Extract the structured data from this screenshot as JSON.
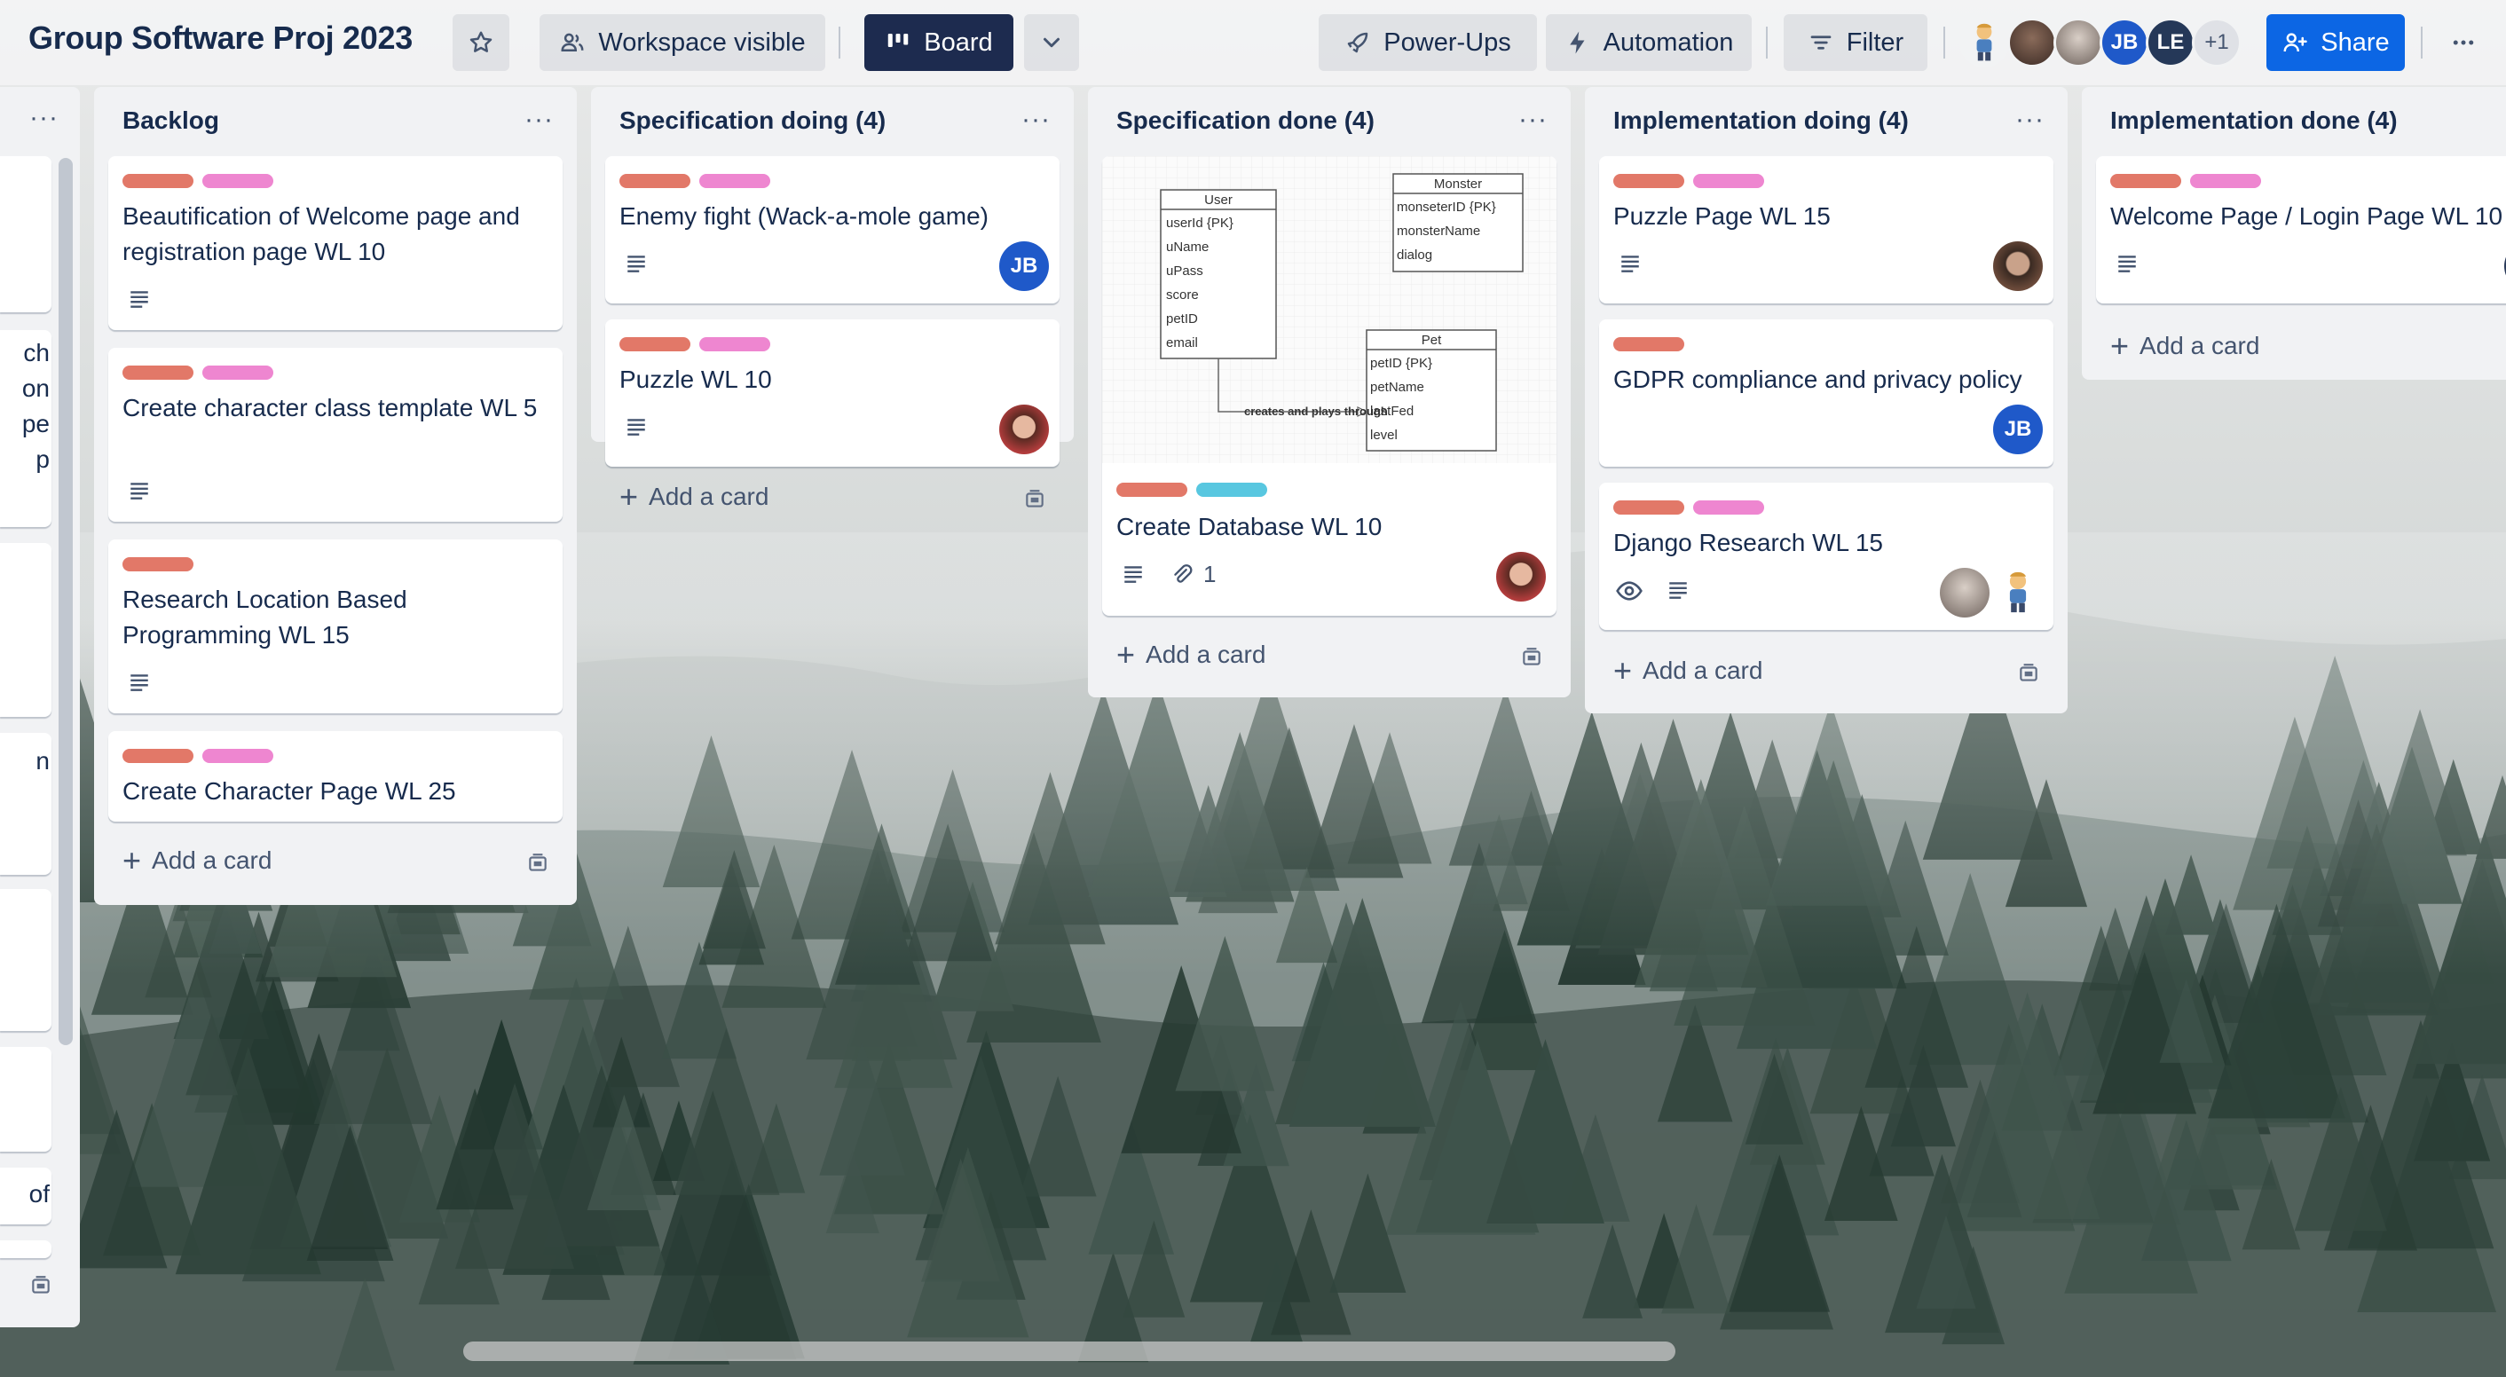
{
  "board": {
    "title": "Group Software Proj 2023",
    "visibility_label": "Workspace visible",
    "view_label": "Board",
    "powerups_label": "Power-Ups",
    "automation_label": "Automation",
    "filter_label": "Filter",
    "share_label": "Share",
    "members": [
      {
        "initials": "JB",
        "color": "#1f59c9"
      },
      {
        "initials": "LE",
        "color": "#253858"
      }
    ],
    "extra_members": "+1"
  },
  "partial_list": {
    "menu": "···",
    "fragments": [
      "ch",
      "on",
      "pe",
      "p",
      "n",
      "of"
    ]
  },
  "lists": [
    {
      "title": "Backlog",
      "menu": "···",
      "add_card": "Add a card",
      "cards": [
        {
          "title": "Beautification of Welcome page and registration page WL 10",
          "labels": [
            "red",
            "pink"
          ],
          "has_description": true
        },
        {
          "title": "Create character class template WL 5",
          "labels": [
            "red",
            "pink"
          ],
          "has_description": true
        },
        {
          "title": "Research Location Based Programming WL 15",
          "labels": [
            "red"
          ],
          "has_description": true
        },
        {
          "title": "Create Character Page WL 25",
          "labels": [
            "red",
            "pink"
          ],
          "has_description": false
        }
      ]
    },
    {
      "title": "Specification doing (4)",
      "menu": "···",
      "add_card": "Add a card",
      "cards": [
        {
          "title": "Enemy fight (Wack-a-mole game)",
          "labels": [
            "red",
            "pink"
          ],
          "has_description": true,
          "member": "JB"
        },
        {
          "title": "Puzzle WL 10",
          "labels": [
            "red",
            "pink"
          ],
          "has_description": true,
          "member": "photo"
        }
      ]
    },
    {
      "title": "Specification done (4)",
      "menu": "···",
      "add_card": "Add a card",
      "cards": [
        {
          "title": "Create Database WL 10",
          "labels": [
            "red",
            "cyan"
          ],
          "has_description": true,
          "attachments": "1",
          "member": "photo",
          "cover": {
            "user": {
              "name": "User",
              "fields": [
                "userId {PK}",
                "uName",
                "uPass",
                "score",
                "petID",
                "email"
              ]
            },
            "monster": {
              "name": "Monster",
              "fields": [
                "monseterID {PK}",
                "monsterName",
                "dialog"
              ]
            },
            "pet": {
              "name": "Pet",
              "fields": [
                "petID {PK}",
                "petName",
                "lastFed",
                "level"
              ]
            },
            "relation": "creates and plays through"
          }
        }
      ]
    },
    {
      "title": "Implementation doing (4)",
      "menu": "···",
      "add_card": "Add a card",
      "cards": [
        {
          "title": "Puzzle Page WL 15",
          "labels": [
            "red",
            "pink"
          ],
          "has_description": true,
          "member": "photo"
        },
        {
          "title": "GDPR compliance and privacy policy",
          "labels": [
            "red"
          ],
          "has_description": false,
          "member": "JB"
        },
        {
          "title": "Django Research WL 15",
          "labels": [
            "red",
            "pink"
          ],
          "has_description": true,
          "watching": true,
          "members": [
            "photo",
            "figure"
          ]
        }
      ]
    },
    {
      "title": "Implementation done (4)",
      "menu": "···",
      "add_card": "Add a card",
      "cards": [
        {
          "title": "Welcome Page / Login Page WL 10",
          "labels": [
            "red",
            "pink"
          ],
          "has_description": true
        }
      ]
    }
  ],
  "colors": {
    "label_red": "#e27868",
    "label_pink": "#ee86d0",
    "label_cyan": "#58c7e0",
    "board_button_dark": "#1d2b4f",
    "share_blue": "#0c66e4"
  }
}
